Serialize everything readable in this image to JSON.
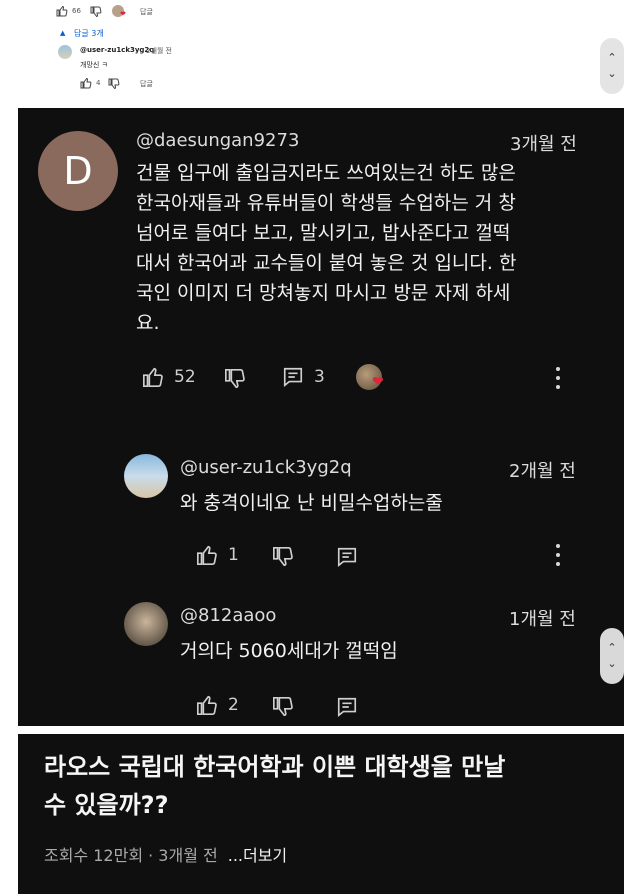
{
  "top": {
    "like_count": "66",
    "reply_label": "답글",
    "replies_toggle": "답글 3개",
    "reply": {
      "user": "@user-zu1ck3yg2q",
      "time": "2개월 전",
      "text": "개망신 ㅋ",
      "like_count": "4",
      "reply_label": "답글"
    }
  },
  "comment": {
    "avatar_letter": "D",
    "user": "@daesungan9273",
    "time": "3개월 전",
    "lines": [
      "건물 입구에 출입금지라도 쓰여있는건 하도 많은",
      "한국아재들과 유튜버들이 학생들 수업하는 거 창",
      "넘어로 들여다 보고, 말시키고, 밥사준다고 껄떡",
      "대서 한국어과 교수들이 붙여 놓은 것 입니다. 한",
      "국인 이미지 더 망쳐놓지 마시고 방문 자제 하세",
      "요."
    ],
    "like_count": "52",
    "reply_count": "3"
  },
  "replies": [
    {
      "user": "@user-zu1ck3yg2q",
      "time": "2개월 전",
      "text": "와 충격이네요 난 비밀수업하는줄",
      "like_count": "1"
    },
    {
      "user": "@812aaoo",
      "time": "1개월 전",
      "text": "거의다 5060세대가 껄떡임",
      "like_count": "2"
    }
  ],
  "video": {
    "title_line1": "라오스 국립대 한국어학과 이쁜 대학생을 만날",
    "title_line2": "수 있을까??",
    "meta": "조회수 12만회 · 3개월 전",
    "more": "...더보기"
  },
  "colors": {
    "dark_bg": "#0f0f0f",
    "avatar_d": "#8a6a5c",
    "heart": "#e0243b",
    "reply_toggle": "#065fd4"
  },
  "icons": [
    "thumb-up-icon",
    "thumb-down-icon",
    "comment-icon",
    "more-vert-icon",
    "chevron-up-icon",
    "chevron-down-icon",
    "heart-icon"
  ]
}
